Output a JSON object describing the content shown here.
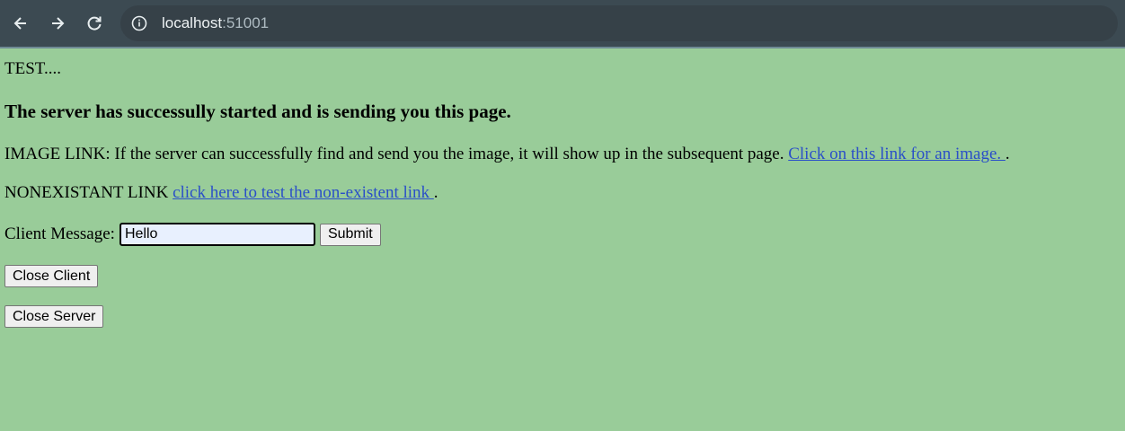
{
  "browser": {
    "url_host": "localhost",
    "url_port": ":51001",
    "icons": [
      "back-arrow-icon",
      "forward-arrow-icon",
      "reload-icon",
      "site-info-icon"
    ]
  },
  "page": {
    "test_text": "TEST....",
    "heading": "The server has successully started and is sending you this page.",
    "image_link_prefix": "IMAGE LINK: If the server can successfully find and send you the image, it will show up in the subsequent page. ",
    "image_link_text": "Click on this link for an image. ",
    "image_link_suffix": ".",
    "nonexistent_prefix": "NONEXISTANT LINK ",
    "nonexistent_link_text": "click here to test the non-existent link ",
    "nonexistent_suffix": ".",
    "client_message_label": "Client Message:",
    "client_message_value": "Hello",
    "submit_label": "Submit",
    "close_client_label": "Close Client",
    "close_server_label": "Close Server"
  },
  "colors": {
    "page_background": "#99cc99",
    "link": "#2a4fc8",
    "toolbar": "#3c4a52"
  }
}
